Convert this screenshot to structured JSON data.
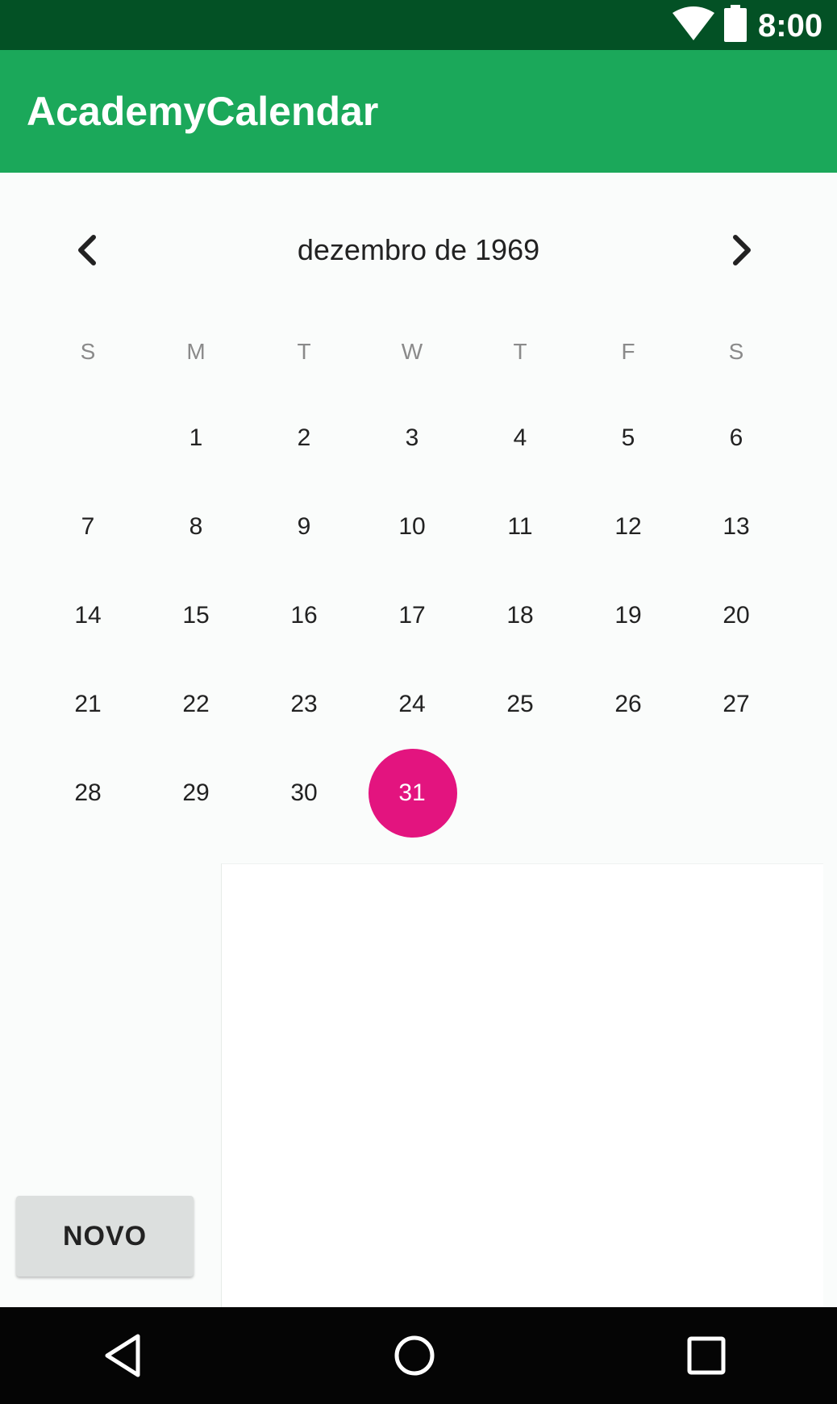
{
  "status_bar": {
    "time": "8:00",
    "icons": [
      "wifi-icon",
      "battery-icon"
    ]
  },
  "app_bar": {
    "title": "AcademyCalendar"
  },
  "calendar": {
    "month_label": "dezembro de 1969",
    "weekdays": [
      "S",
      "M",
      "T",
      "W",
      "T",
      "F",
      "S"
    ],
    "leading_blank_days": 1,
    "days": [
      "1",
      "2",
      "3",
      "4",
      "5",
      "6",
      "7",
      "8",
      "9",
      "10",
      "11",
      "12",
      "13",
      "14",
      "15",
      "16",
      "17",
      "18",
      "19",
      "20",
      "21",
      "22",
      "23",
      "24",
      "25",
      "26",
      "27",
      "28",
      "29",
      "30",
      "31"
    ],
    "selected_day": "31",
    "selected_color": "#e3147f"
  },
  "actions": {
    "novo_label": "NOVO"
  },
  "colors": {
    "status_bar": "#035125",
    "app_bar": "#1ba85a",
    "accent": "#e3147f"
  },
  "nav_bar": {
    "icons": [
      "back-icon",
      "home-icon",
      "recents-icon"
    ]
  }
}
